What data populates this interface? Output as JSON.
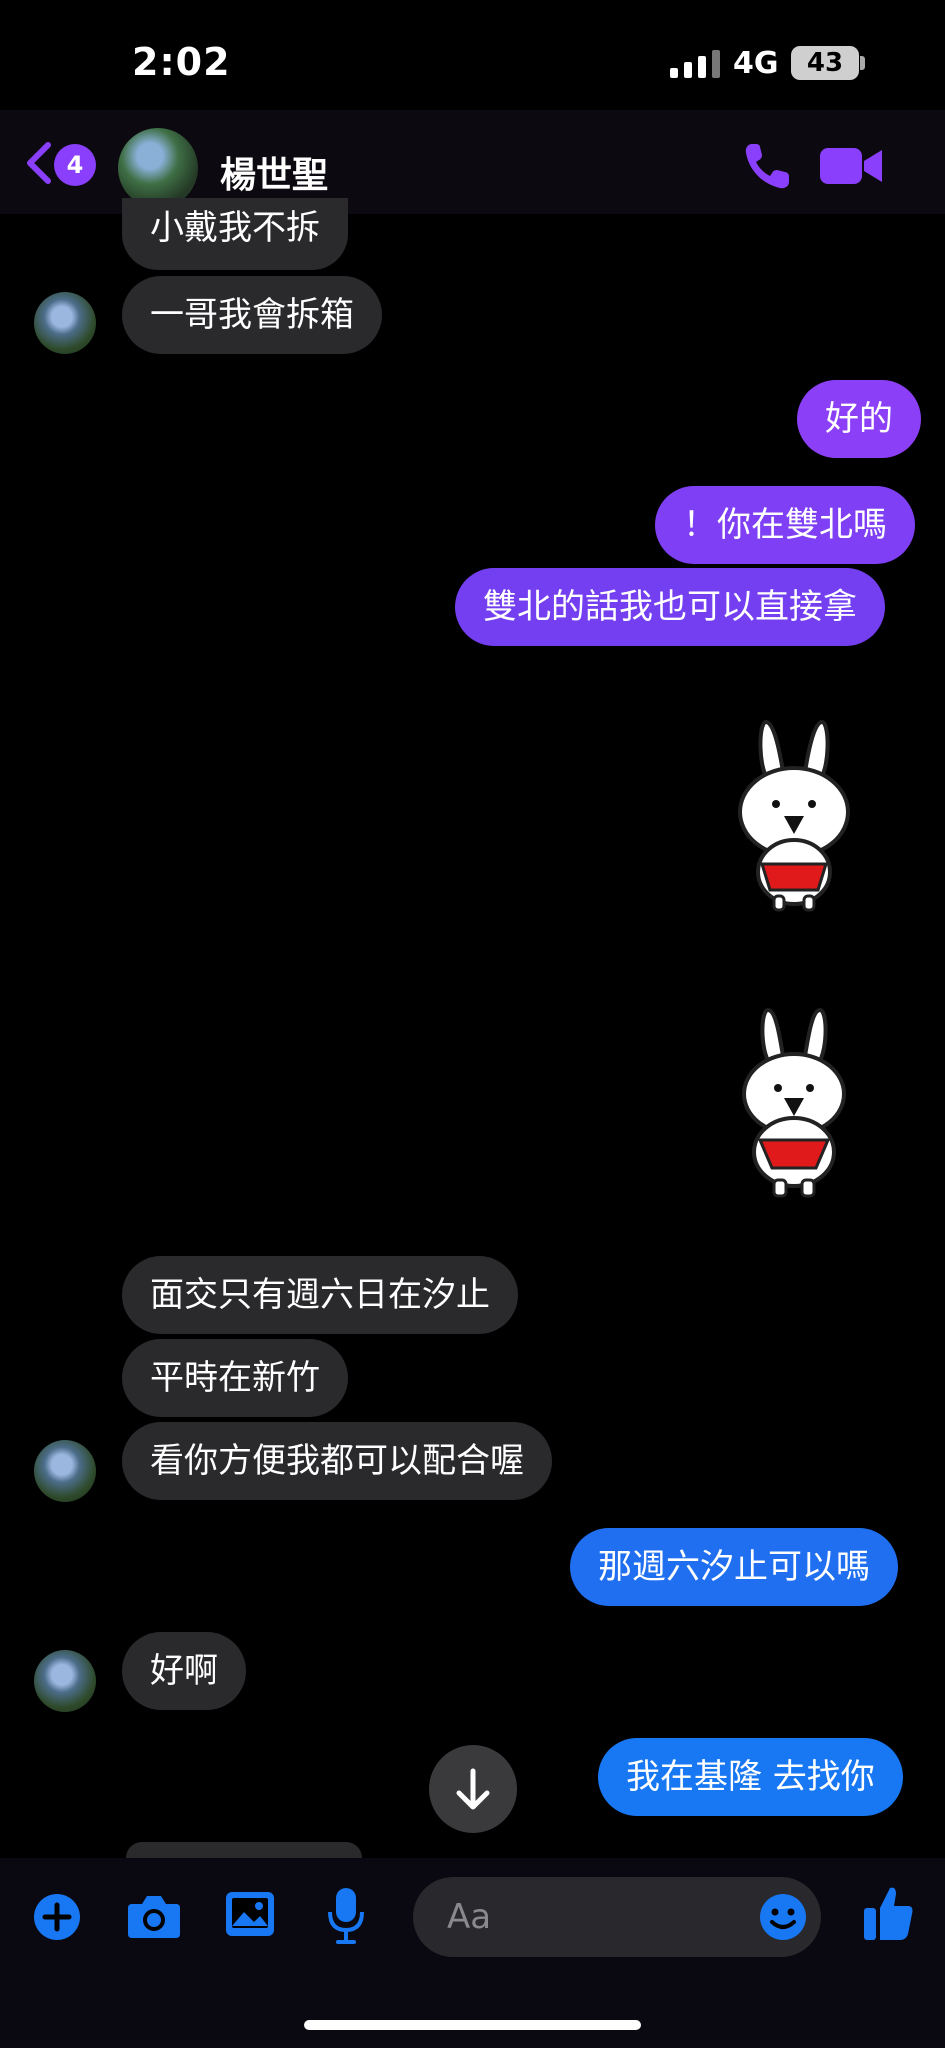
{
  "status_bar": {
    "time": "2:02",
    "network": "4G",
    "battery": "43"
  },
  "header": {
    "back_badge": "4",
    "contact_name": "楊世聖"
  },
  "messages": [
    {
      "from": "them",
      "text": "小戴我不拆"
    },
    {
      "from": "them",
      "text": "一哥我會拆箱"
    },
    {
      "from": "me",
      "text": "好的"
    },
    {
      "from": "me",
      "text": "！你在雙北嗎"
    },
    {
      "from": "me",
      "text": "雙北的話我也可以直接拿"
    },
    {
      "from": "me",
      "type": "sticker",
      "sticker": "rabbit-sticker"
    },
    {
      "from": "me",
      "type": "sticker",
      "sticker": "rabbit-sticker"
    },
    {
      "from": "them",
      "text": "面交只有週六日在汐止"
    },
    {
      "from": "them",
      "text": "平時在新竹"
    },
    {
      "from": "them",
      "text": "看你方便我都可以配合喔"
    },
    {
      "from": "me",
      "text": "那週六汐止可以嗎"
    },
    {
      "from": "them",
      "text": "好啊"
    },
    {
      "from": "me",
      "text": "我在基隆 去找你"
    }
  ],
  "composer": {
    "placeholder": "Aa"
  },
  "colors": {
    "accent_purple": "#8a3ffc",
    "bubble_incoming": "#2a2a2d",
    "bubble_purple": "#7b3ff2",
    "bubble_blue": "#1877f2"
  },
  "icons": [
    "back-chevron-icon",
    "phone-icon",
    "video-icon",
    "plus-icon",
    "camera-icon",
    "image-icon",
    "microphone-icon",
    "emoji-icon",
    "thumbs-up-icon",
    "arrow-down-icon"
  ]
}
